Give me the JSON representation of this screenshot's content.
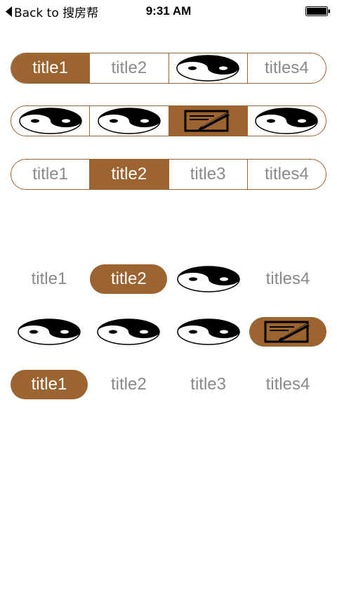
{
  "status_bar": {
    "back_label": "Back to 搜房帮",
    "time": "9:31 AM"
  },
  "accent_color": "#9b6430",
  "text_color": "#8a8a8a",
  "bordered_controls": [
    {
      "items": [
        {
          "type": "text",
          "label": "title1",
          "selected": true
        },
        {
          "type": "text",
          "label": "title2",
          "selected": false
        },
        {
          "type": "icon",
          "icon": "yin-yang-icon",
          "selected": false
        },
        {
          "type": "text",
          "label": "titles4",
          "selected": false
        }
      ]
    },
    {
      "items": [
        {
          "type": "icon",
          "icon": "yin-yang-icon",
          "selected": false
        },
        {
          "type": "icon",
          "icon": "yin-yang-icon",
          "selected": false
        },
        {
          "type": "icon",
          "icon": "edit-icon",
          "selected": true
        },
        {
          "type": "icon",
          "icon": "yin-yang-icon",
          "selected": false
        }
      ]
    },
    {
      "items": [
        {
          "type": "text",
          "label": "title1",
          "selected": false
        },
        {
          "type": "text",
          "label": "title2",
          "selected": true
        },
        {
          "type": "text",
          "label": "title3",
          "selected": false
        },
        {
          "type": "text",
          "label": "titles4",
          "selected": false
        }
      ]
    }
  ],
  "pill_controls": [
    {
      "items": [
        {
          "type": "text",
          "label": "title1",
          "selected": false
        },
        {
          "type": "text",
          "label": "title2",
          "selected": true
        },
        {
          "type": "icon",
          "icon": "yin-yang-icon",
          "selected": false
        },
        {
          "type": "text",
          "label": "titles4",
          "selected": false
        }
      ]
    },
    {
      "items": [
        {
          "type": "icon",
          "icon": "yin-yang-icon",
          "selected": false
        },
        {
          "type": "icon",
          "icon": "yin-yang-icon",
          "selected": false
        },
        {
          "type": "icon",
          "icon": "yin-yang-icon",
          "selected": false
        },
        {
          "type": "icon",
          "icon": "edit-icon",
          "selected": true
        }
      ]
    },
    {
      "items": [
        {
          "type": "text",
          "label": "title1",
          "selected": true
        },
        {
          "type": "text",
          "label": "title2",
          "selected": false
        },
        {
          "type": "text",
          "label": "title3",
          "selected": false
        },
        {
          "type": "text",
          "label": "titles4",
          "selected": false
        }
      ]
    }
  ]
}
